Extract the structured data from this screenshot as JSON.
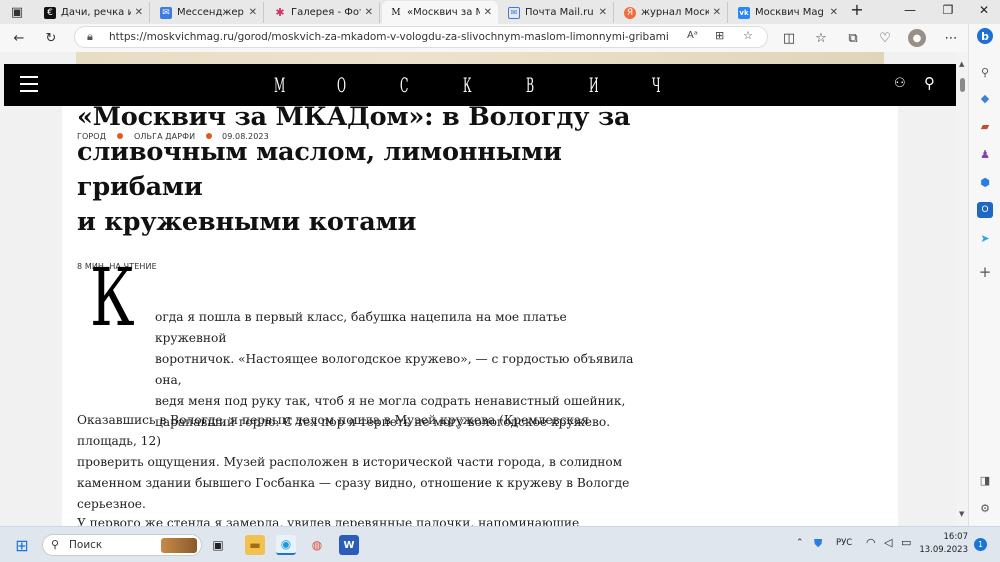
{
  "tabs": [
    {
      "label": "Дачи, речка и Со",
      "icon": "€"
    },
    {
      "label": "Мессенджер",
      "icon": "✉"
    },
    {
      "label": "Галерея - Фотогр",
      "icon": "✱"
    },
    {
      "label": "«Москвич за МК",
      "icon": "М"
    },
    {
      "label": "Почта Mail.ru",
      "icon": "✉"
    },
    {
      "label": "журнал Москвич",
      "icon": "Я"
    },
    {
      "label": "Москвич Mag",
      "icon": "vk"
    }
  ],
  "address": {
    "url": "https://moskvichmag.ru/gorod/moskvich-za-mkadom-v-vologdu-za-slivochnym-maslom-limonnymi-gribami-i-kruzhevnymi..."
  },
  "site": {
    "logo_letters": [
      "М",
      "О",
      "С",
      "К",
      "В",
      "И",
      "Ч"
    ]
  },
  "article": {
    "category": "ГОРОД",
    "author": "ОЛЬГА ДАРФИ",
    "date": "09.08.2023",
    "title_lines": [
      "«Москвич за МКАДом»: в Вологду за",
      "сливочным маслом, лимонными грибами",
      "и кружевными котами"
    ],
    "read_time": "8 МИН. НА ЧТЕНИЕ",
    "drop_cap": "К",
    "p1_lines": [
      "огда я пошла в первый класс, бабушка нацепила на мое платье кружевной",
      "воротничок. «Настоящее вологодское кружево», — с гордостью объявила она,",
      "ведя меня под руку так, чтоб я не могла содрать ненавистный ошейник,",
      "царапавший горло. С тех пор я терпеть не могу вологодское кружево."
    ],
    "p2_lines": [
      "Оказавшись в Вологде, я первым делом пошла в Музей кружева (Кремлевская площадь, 12)",
      "проверить ощущения. Музей расположен в исторической части города, в солидном",
      "каменном здании бывшего Госбанка — сразу видно, отношение к кружеву в Вологде",
      "серьезное."
    ],
    "p3_line": "У первого же стенда я замерла, увидев деревянные палочки, напоминающие барабанные"
  },
  "taskbar": {
    "search_placeholder": "Поиск",
    "lang": "РУС",
    "time": "16:07",
    "date": "13.09.2023",
    "notif_count": "1"
  }
}
